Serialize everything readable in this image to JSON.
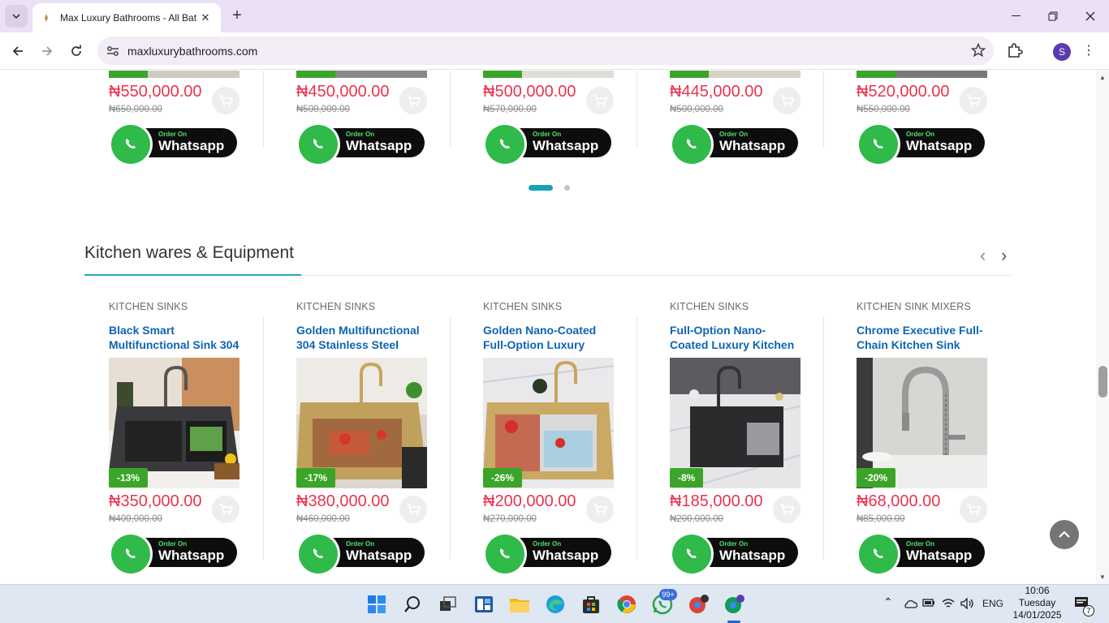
{
  "browser": {
    "tab_title": "Max Luxury Bathrooms - All Bat",
    "url": "maxluxurybathrooms.com",
    "profile_initial": "S"
  },
  "top_row": [
    {
      "price": "₦550,000.00",
      "old_price": "₦650,000.00"
    },
    {
      "price": "₦450,000.00",
      "old_price": "₦500,000.00"
    },
    {
      "price": "₦500,000.00",
      "old_price": "₦570,000.00"
    },
    {
      "price": "₦445,000.00",
      "old_price": "₦500,000.00"
    },
    {
      "price": "₦520,000.00",
      "old_price": "₦550,000.00"
    }
  ],
  "whatsapp": {
    "small": "Order On",
    "big": "Whatsapp"
  },
  "section": {
    "title": "Kitchen wares & Equipment"
  },
  "products": [
    {
      "category": "KITCHEN SINKS",
      "name": "Black Smart Multifunctional Sink 304",
      "discount": "-13%",
      "price": "₦350,000.00",
      "old_price": "₦400,000.00",
      "photo": "dark-sink"
    },
    {
      "category": "KITCHEN SINKS",
      "name": "Golden Multifunctional 304 Stainless Steel",
      "discount": "-17%",
      "price": "₦380,000.00",
      "old_price": "₦460,000.00",
      "photo": "gold-sink"
    },
    {
      "category": "KITCHEN SINKS",
      "name": "Golden Nano-Coated Full-Option Luxury",
      "discount": "-26%",
      "price": "₦200,000.00",
      "old_price": "₦270,000.00",
      "photo": "gold-sink-marble"
    },
    {
      "category": "KITCHEN SINKS",
      "name": "Full-Option Nano-Coated Luxury Kitchen",
      "discount": "-8%",
      "price": "₦185,000.00",
      "old_price": "₦200,000.00",
      "photo": "black-sink-marble"
    },
    {
      "category": "KITCHEN SINK MIXERS",
      "name": "Chrome Executive Full-Chain Kitchen Sink",
      "discount": "-20%",
      "price": "₦68,000.00",
      "old_price": "₦85,000.00",
      "photo": "chrome-mixer"
    }
  ],
  "taskbar": {
    "whatsapp_badge": "99+",
    "lang": "ENG",
    "time": "10:06",
    "day": "Tuesday",
    "date": "14/01/2025",
    "notifications": "7"
  },
  "colors": {
    "price": "#e8344e",
    "name": "#0e65b3",
    "badge": "#3aa528",
    "accent": "#27a6c2"
  }
}
